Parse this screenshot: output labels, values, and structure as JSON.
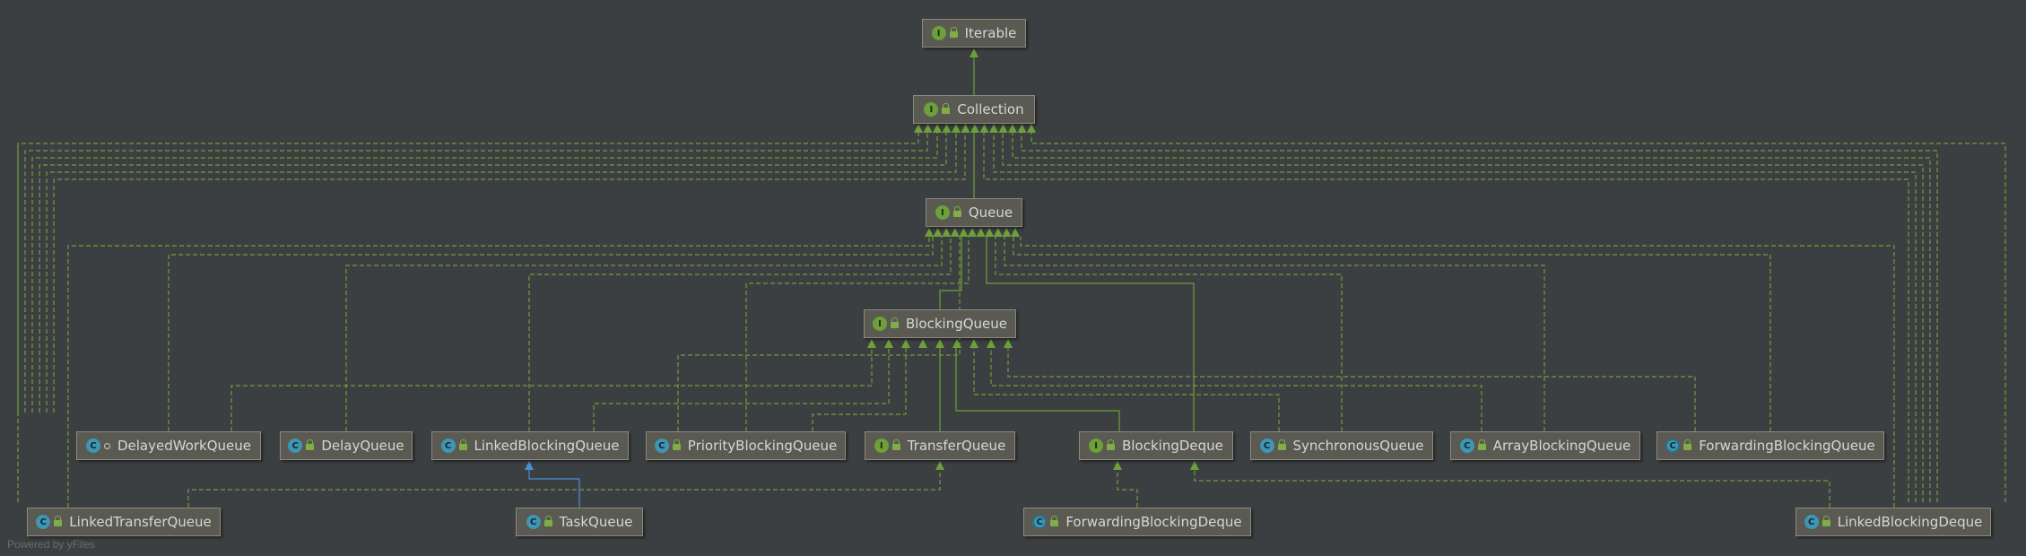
{
  "nodes": {
    "iterable": {
      "label": "Iterable",
      "kind": "interface"
    },
    "collection": {
      "label": "Collection",
      "kind": "interface"
    },
    "queue": {
      "label": "Queue",
      "kind": "interface"
    },
    "blocking_queue": {
      "label": "BlockingQueue",
      "kind": "interface"
    },
    "delayed_work_queue": {
      "label": "DelayedWorkQueue",
      "kind": "class"
    },
    "delay_queue": {
      "label": "DelayQueue",
      "kind": "class"
    },
    "linked_blocking_queue": {
      "label": "LinkedBlockingQueue",
      "kind": "class"
    },
    "priority_blocking_queue": {
      "label": "PriorityBlockingQueue",
      "kind": "class"
    },
    "transfer_queue": {
      "label": "TransferQueue",
      "kind": "interface"
    },
    "blocking_deque": {
      "label": "BlockingDeque",
      "kind": "interface"
    },
    "synchronous_queue": {
      "label": "SynchronousQueue",
      "kind": "class"
    },
    "array_blocking_queue": {
      "label": "ArrayBlockingQueue",
      "kind": "class"
    },
    "forwarding_blocking_queue": {
      "label": "ForwardingBlockingQueue",
      "kind": "abstract-class"
    },
    "linked_transfer_queue": {
      "label": "LinkedTransferQueue",
      "kind": "class"
    },
    "task_queue": {
      "label": "TaskQueue",
      "kind": "class"
    },
    "forwarding_blocking_deque": {
      "label": "ForwardingBlockingDeque",
      "kind": "abstract-class"
    },
    "linked_blocking_deque": {
      "label": "LinkedBlockingDeque",
      "kind": "class"
    }
  },
  "badges": {
    "interface": "I",
    "class": "C",
    "abstract-class": "C"
  },
  "edges": [
    {
      "from": "collection",
      "to": "iterable",
      "style": "extends"
    },
    {
      "from": "queue",
      "to": "collection",
      "style": "extends"
    },
    {
      "from": "blocking_queue",
      "to": "queue",
      "style": "extends"
    },
    {
      "from": "task_queue",
      "to": "linked_blocking_queue",
      "style": "class-extends"
    },
    {
      "from": "linked_transfer_queue",
      "to": "transfer_queue",
      "style": "implements"
    },
    {
      "from": "forwarding_blocking_deque",
      "to": "blocking_deque",
      "style": "implements"
    },
    {
      "from": "linked_blocking_deque",
      "to": "blocking_deque",
      "style": "implements"
    },
    {
      "from": "transfer_queue",
      "to": "blocking_queue",
      "style": "extends"
    },
    {
      "from": "blocking_deque",
      "to": "blocking_queue",
      "style": "extends"
    },
    {
      "from": "blocking_deque",
      "to": "queue",
      "style": "extends"
    }
  ],
  "colors": {
    "edge": "#6d9f3b",
    "class_edge": "#4a8fd6",
    "node_bg": "#5a5a52",
    "background": "#3c3f41"
  },
  "credit": "Powered by yFiles"
}
